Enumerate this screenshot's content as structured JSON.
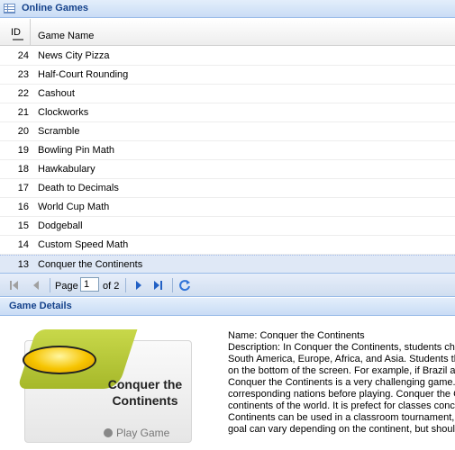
{
  "games_panel": {
    "title": "Online Games"
  },
  "columns": {
    "id": "ID",
    "name": "Game Name"
  },
  "rows": [
    {
      "id": "24",
      "name": "News City Pizza"
    },
    {
      "id": "23",
      "name": "Half-Court Rounding"
    },
    {
      "id": "22",
      "name": "Cashout"
    },
    {
      "id": "21",
      "name": "Clockworks"
    },
    {
      "id": "20",
      "name": "Scramble"
    },
    {
      "id": "19",
      "name": "Bowling Pin Math"
    },
    {
      "id": "18",
      "name": "Hawkabulary"
    },
    {
      "id": "17",
      "name": "Death to Decimals"
    },
    {
      "id": "16",
      "name": "World Cup Math"
    },
    {
      "id": "15",
      "name": "Dodgeball"
    },
    {
      "id": "14",
      "name": "Custom Speed Math"
    },
    {
      "id": "13",
      "name": "Conquer the Continents"
    }
  ],
  "pager": {
    "page_label": "Page",
    "page_value": "1",
    "of_label": "of 2"
  },
  "details_panel": {
    "title": "Game Details"
  },
  "details": {
    "thumb_title_line1": "Conquer the",
    "thumb_title_line2": "Continents",
    "play_label": "Play Game",
    "lines": [
      "Name: Conquer the Continents",
      "Description: In Conquer the Continents, students ch",
      "South America, Europe, Africa, and Asia. Students th",
      "on the bottom of the screen. For example, if Brazil a",
      "Conquer the Continents is a very challenging game.",
      "corresponding nations before playing. Conquer the C",
      "continents of the world. It is prefect for classes conc",
      "Continents can be used in a classroom tournament, c",
      "goal can vary depending on the continent, but shoul"
    ]
  }
}
